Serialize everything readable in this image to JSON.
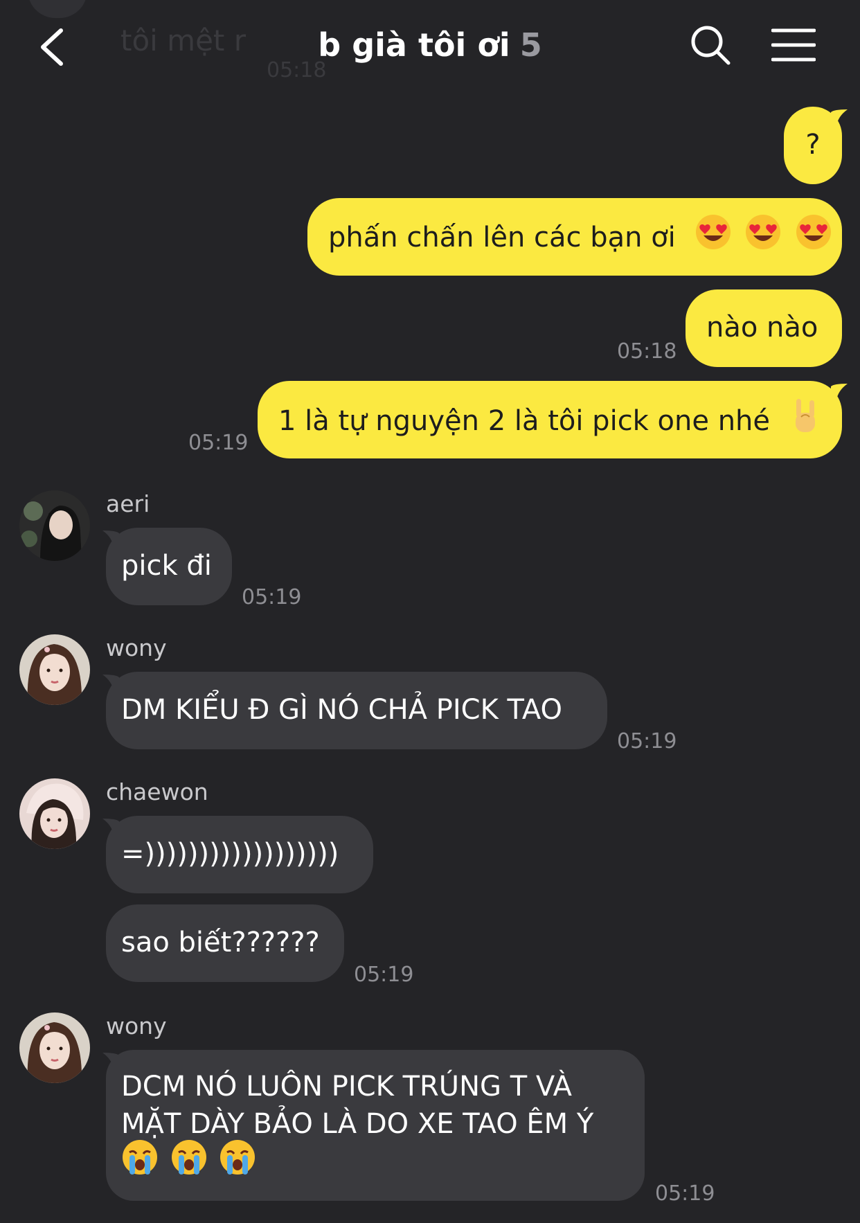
{
  "header": {
    "title": "b già tôi ơi",
    "member_count": "5",
    "ghost_message": "tôi mệt r",
    "ghost_time": "05:18"
  },
  "messages": [
    {
      "from": "me",
      "text": "?",
      "time": ""
    },
    {
      "from": "me",
      "text": "phấn chấn lên các bạn ơi",
      "emoji": [
        "heart-eyes-emoji",
        "heart-eyes-emoji",
        "heart-eyes-emoji"
      ],
      "time": ""
    },
    {
      "from": "me",
      "text": "nào nào",
      "time": "05:18"
    },
    {
      "from": "me",
      "text": "1 là tự nguyện 2 là tôi pick one nhé",
      "emoji": [
        "rock-on-hand-emoji"
      ],
      "time": "05:19"
    },
    {
      "from": "aeri",
      "sender": "aeri",
      "text": "pick đi",
      "time": "05:19"
    },
    {
      "from": "wony",
      "sender": "wony",
      "text": "DM KIỂU Đ GÌ NÓ CHẢ PICK TAO",
      "time": "05:19"
    },
    {
      "from": "chaewon",
      "sender": "chaewon",
      "text": "=))))))))))))))))))",
      "time": ""
    },
    {
      "from": "chaewon",
      "text": "sao biết??????",
      "time": "05:19"
    },
    {
      "from": "wony",
      "sender": "wony",
      "lines": [
        "DCM NÓ LUÔN PICK TRÚNG T VÀ",
        "MẶT DÀY BẢO LÀ DO XE TAO ÊM Ý"
      ],
      "emoji": [
        "crying-emoji",
        "crying-emoji",
        "crying-emoji"
      ],
      "time": "05:19"
    }
  ],
  "colors": {
    "background": "#242427",
    "my_bubble": "#fbe941",
    "other_bubble": "#3a3a3e",
    "timestamp": "#8e8e93"
  }
}
